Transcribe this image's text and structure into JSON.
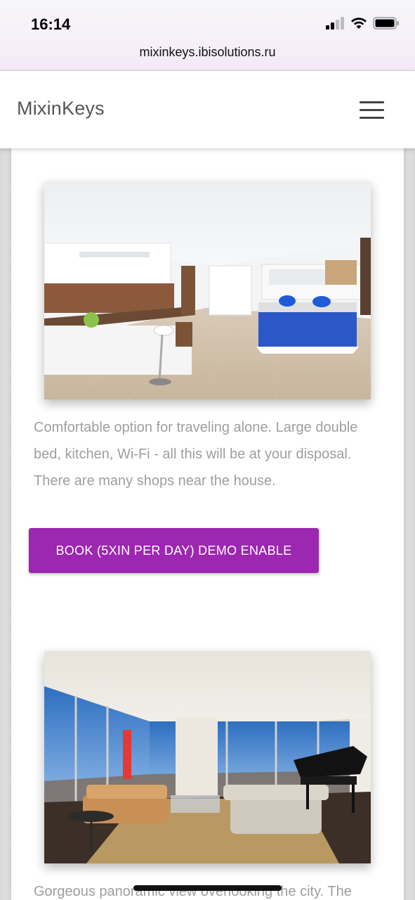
{
  "status_bar": {
    "time": "16:14",
    "icons": [
      "signal-icon",
      "wifi-icon",
      "battery-icon"
    ]
  },
  "browser": {
    "url": "mixinkeys.ibisolutions.ru"
  },
  "header": {
    "brand": "MixinKeys",
    "menu_icon": "hamburger-menu-icon"
  },
  "listings": [
    {
      "image": "apartment-studio-photo",
      "description": "Comfortable option for traveling alone. Large double bed, kitchen, Wi-Fi - all this will be at your disposal. There are many shops near the house.",
      "book_label": "BOOK (5XIN PER DAY) DEMO ENABLE"
    },
    {
      "image": "panoramic-living-room-photo",
      "description": "Gorgeous panoramic view overlooking the city. The"
    }
  ],
  "colors": {
    "accent": "#9c27b0",
    "brand_text": "#555555",
    "description_text": "#9e9e9e"
  }
}
